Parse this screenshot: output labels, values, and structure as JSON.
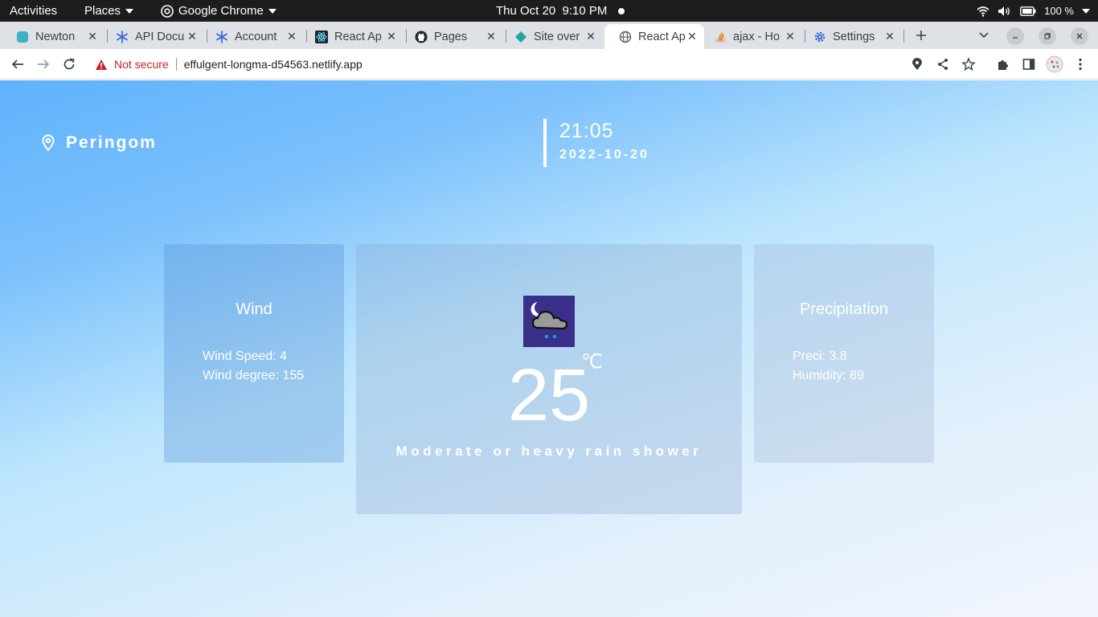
{
  "system_bar": {
    "activities": "Activities",
    "places": "Places",
    "app": "Google Chrome",
    "clock": "Thu Oct 20  9:10 PM",
    "battery": "100 %"
  },
  "tabs": [
    {
      "title": "Newton",
      "icon": "newton-icon",
      "active": false
    },
    {
      "title": "API Docu",
      "icon": "snowflake-icon",
      "active": false
    },
    {
      "title": "Account",
      "icon": "snowflake-icon",
      "active": false
    },
    {
      "title": "React Ap",
      "icon": "react-icon",
      "active": false
    },
    {
      "title": "Pages",
      "icon": "github-icon",
      "active": false
    },
    {
      "title": "Site over",
      "icon": "netlify-icon",
      "active": false
    },
    {
      "title": "React Ap",
      "icon": "globe-icon",
      "active": true
    },
    {
      "title": "ajax - Ho",
      "icon": "stackoverflow-icon",
      "active": false
    },
    {
      "title": "Settings",
      "icon": "gear-icon",
      "active": false
    }
  ],
  "toolbar": {
    "security": "Not secure",
    "url": "effulgent-longma-d54563.netlify.app"
  },
  "weather": {
    "location": "Peringom",
    "time": "21:05",
    "date": "2022-10-20",
    "wind": {
      "title": "Wind",
      "speed": "Wind Speed: 4",
      "degree": "Wind degree: 155"
    },
    "current": {
      "temperature": "25",
      "unit": "℃",
      "condition": "Moderate or heavy rain shower",
      "icon": "night-rain-icon"
    },
    "precipitation": {
      "title": "Precipitation",
      "preci": "Preci: 3.8",
      "humidity": "Humidity: 89"
    }
  },
  "colors": {
    "page_gradient_start": "#5fb2fc",
    "page_gradient_end": "#f3f5fd",
    "not_secure": "#c5221f",
    "tab_strip": "#dee1e6",
    "weather_icon_bg": "#3b2f8c"
  }
}
